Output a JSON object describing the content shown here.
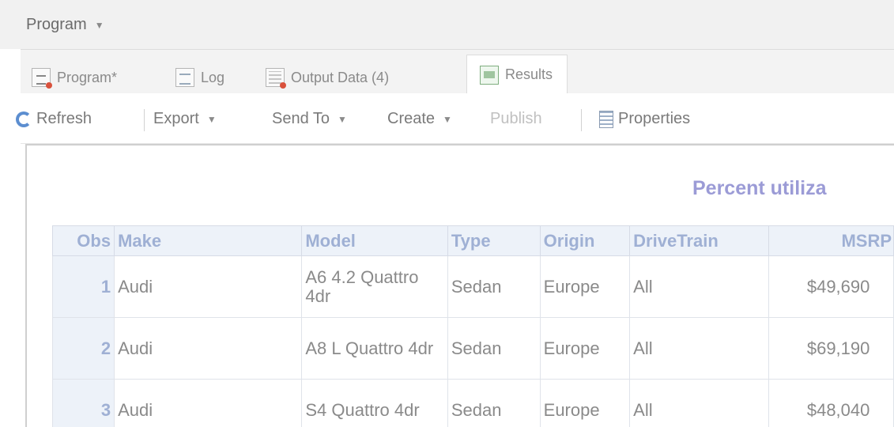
{
  "program_menu": {
    "label": "Program"
  },
  "tabs": [
    {
      "label": "Program*",
      "icon": "program-icon"
    },
    {
      "label": "Log",
      "icon": "log-icon"
    },
    {
      "label": "Output Data (4)",
      "icon": "output-data-icon"
    },
    {
      "label": "Results",
      "icon": "results-icon",
      "active": true
    }
  ],
  "toolbar": {
    "refresh": "Refresh",
    "export": "Export",
    "send_to": "Send To",
    "create": "Create",
    "publish": "Publish",
    "properties": "Properties"
  },
  "report": {
    "title": "Percent utiliza",
    "columns": [
      "Obs",
      "Make",
      "Model",
      "Type",
      "Origin",
      "DriveTrain",
      "MSRP"
    ],
    "rows": [
      {
        "obs": "1",
        "make": "Audi",
        "model": "A6 4.2 Quattro 4dr",
        "type": "Sedan",
        "origin": "Europe",
        "drivetrain": "All",
        "msrp": "$49,690"
      },
      {
        "obs": "2",
        "make": "Audi",
        "model": "A8 L Quattro 4dr",
        "type": "Sedan",
        "origin": "Europe",
        "drivetrain": "All",
        "msrp": "$69,190"
      },
      {
        "obs": "3",
        "make": "Audi",
        "model": "S4 Quattro 4dr",
        "type": "Sedan",
        "origin": "Europe",
        "drivetrain": "All",
        "msrp": "$48,040"
      }
    ]
  },
  "colors": {
    "accent_title": "#9b9bd6",
    "header_text": "#9fb0d4",
    "header_bg": "#edf2f9"
  }
}
